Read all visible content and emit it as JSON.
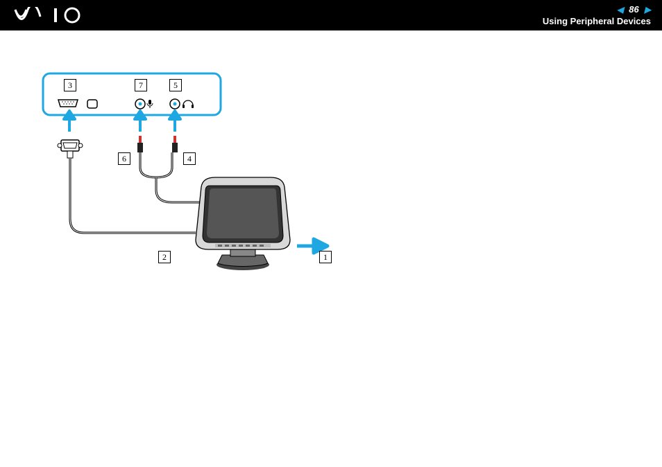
{
  "header": {
    "page_number": "86",
    "section": "Using Peripheral Devices",
    "logo_alt": "VAIO"
  },
  "diagram": {
    "callouts": {
      "c1": "1",
      "c2": "2",
      "c3": "3",
      "c4": "4",
      "c5": "5",
      "c6": "6",
      "c7": "7"
    }
  },
  "colors": {
    "accent": "#1ea7e1"
  }
}
